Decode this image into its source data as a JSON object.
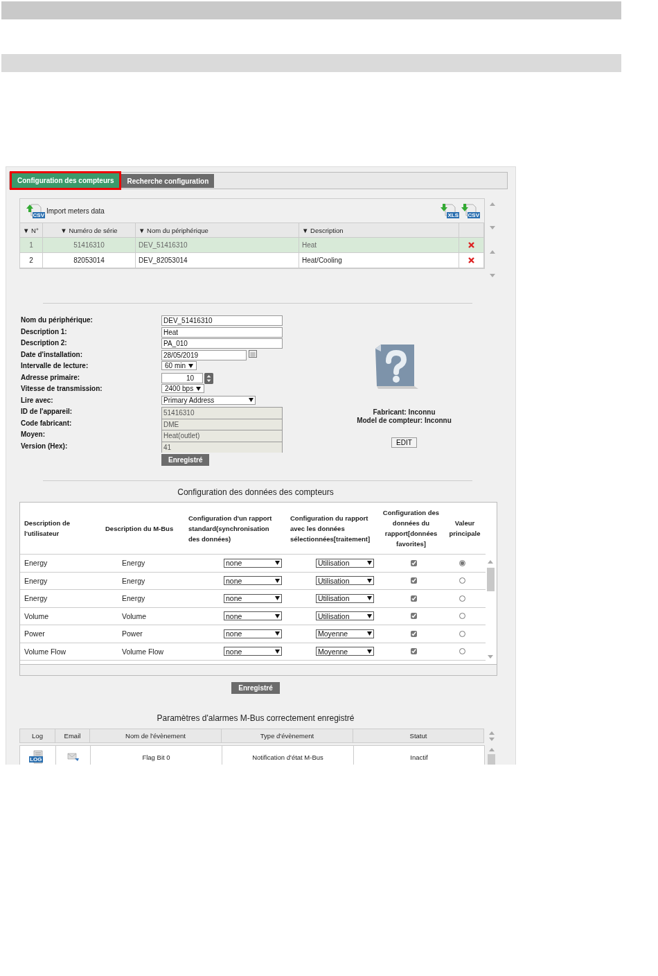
{
  "tabs": [
    {
      "label": "Configuration des compteurs",
      "selected": true
    },
    {
      "label": "Recherche configuration",
      "selected": false
    }
  ],
  "meters": {
    "import_label": "Import meters data",
    "import_badge": "CSV",
    "export_badges": [
      "XLS",
      "CSV"
    ],
    "columns": [
      "▼ N°",
      "▼ Numéro de série",
      "▼ Nom du périphérique",
      "▼ Description"
    ],
    "rows": [
      {
        "no": "1",
        "serial": "51416310",
        "name": "DEV_51416310",
        "description": "Heat",
        "selected": true
      },
      {
        "no": "2",
        "serial": "82053014",
        "name": "DEV_82053014",
        "description": "Heat/Cooling",
        "selected": false
      }
    ]
  },
  "form": {
    "fields": [
      {
        "label": "Nom du périphérique:",
        "kind": "text",
        "value": "DEV_51416310"
      },
      {
        "label": "Description 1:",
        "kind": "text",
        "value": "Heat"
      },
      {
        "label": "Description 2:",
        "kind": "text",
        "value": "PA_010"
      },
      {
        "label": "Date d'installation:",
        "kind": "date",
        "value": "28/05/2019"
      },
      {
        "label": "Intervalle de lecture:",
        "kind": "select",
        "value": "60 min"
      },
      {
        "label": "Adresse primaire:",
        "kind": "spin",
        "value": "10"
      },
      {
        "label": "Vitesse de transmission:",
        "kind": "select",
        "value": "2400 bps"
      },
      {
        "label": "Lire avec:",
        "kind": "select-wide",
        "value": "Primary Address"
      },
      {
        "label": "ID de l'appareil:",
        "kind": "readonly",
        "value": "51416310"
      },
      {
        "label": "Code fabricant:",
        "kind": "readonly",
        "value": "DME"
      },
      {
        "label": "Moyen:",
        "kind": "readonly",
        "value": "Heat(outlet)"
      },
      {
        "label": "Version (Hex):",
        "kind": "readonly",
        "value": "41"
      }
    ],
    "save_button": "Enregistré"
  },
  "device_info": {
    "manufacturer": "Fabricant: Inconnu",
    "model": "Model de compteur: Inconnu",
    "edit_button": "EDIT"
  },
  "data_config": {
    "title": "Configuration des données des compteurs",
    "columns": [
      "Description de l'utilisateur",
      "Description du M-Bus",
      "Configuration d'un rapport standard(synchronisation des données)",
      "Configuration du rapport avec les données sélectionnées[traitement]",
      "Configuration des données du rapport[données favorites]",
      "Valeur principale"
    ],
    "rows": [
      {
        "user_description": "Energy",
        "mbus_description": "Energy",
        "standard_report": "none",
        "selected_report": "Utilisation",
        "favorite": true,
        "selected": true
      },
      {
        "user_description": "Energy",
        "mbus_description": "Energy",
        "standard_report": "none",
        "selected_report": "Utilisation",
        "favorite": true,
        "selected": false
      },
      {
        "user_description": "Energy",
        "mbus_description": "Energy",
        "standard_report": "none",
        "selected_report": "Utilisation",
        "favorite": true,
        "selected": false
      },
      {
        "user_description": "Volume",
        "mbus_description": "Volume",
        "standard_report": "none",
        "selected_report": "Utilisation",
        "favorite": true,
        "selected": false
      },
      {
        "user_description": "Power",
        "mbus_description": "Power",
        "standard_report": "none",
        "selected_report": "Moyenne",
        "favorite": true,
        "selected": false
      },
      {
        "user_description": "Volume Flow",
        "mbus_description": "Volume Flow",
        "standard_report": "none",
        "selected_report": "Moyenne",
        "favorite": true,
        "selected": false
      }
    ],
    "save_button": "Enregistré"
  },
  "alarms": {
    "title": "Paramètres d'alarmes M-Bus correctement enregistré",
    "columns": [
      "Log",
      "Email",
      "Nom de l'évènement",
      "Type d'évènement",
      "Statut"
    ],
    "rows": [
      {
        "log_badge": "LOG",
        "event_name": "Flag Bit 0",
        "event_type": "Notification d'état M-Bus",
        "status": "Inactif"
      }
    ]
  }
}
